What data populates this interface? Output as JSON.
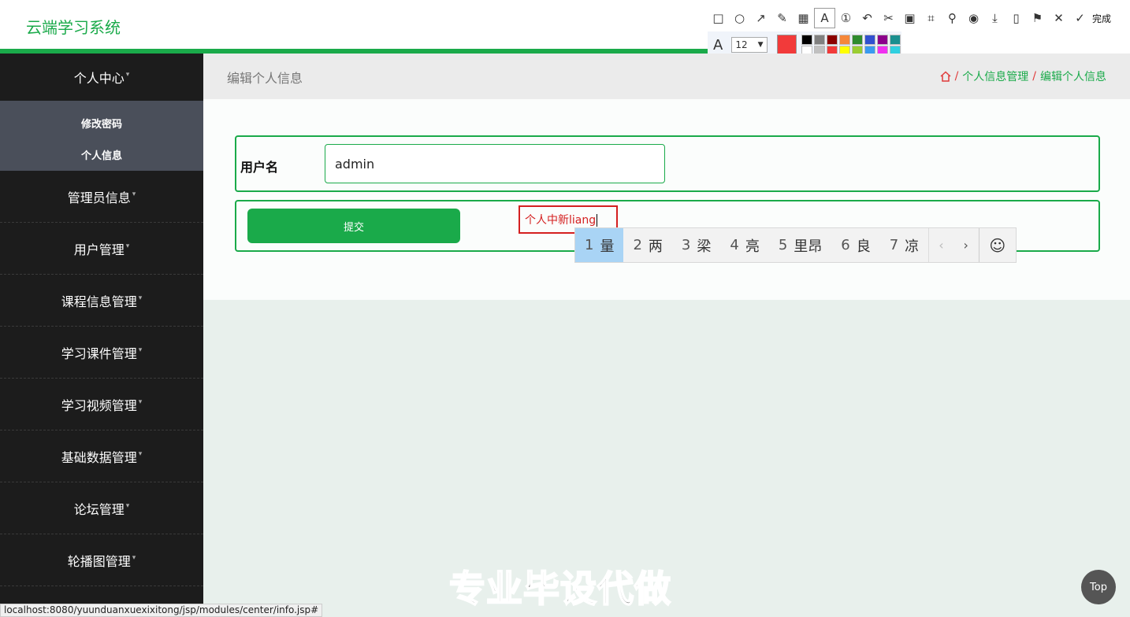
{
  "header": {
    "brand": "云端学习系统"
  },
  "sidebar": {
    "items": [
      {
        "label": "个人中心"
      },
      {
        "label": "管理员信息"
      },
      {
        "label": "用户管理"
      },
      {
        "label": "课程信息管理"
      },
      {
        "label": "学习课件管理"
      },
      {
        "label": "学习视频管理"
      },
      {
        "label": "基础数据管理"
      },
      {
        "label": "论坛管理"
      },
      {
        "label": "轮播图管理"
      }
    ],
    "submenu": [
      {
        "label": "修改密码"
      },
      {
        "label": "个人信息"
      }
    ]
  },
  "page": {
    "title": "编辑个人信息",
    "breadcrumb": [
      "个人信息管理",
      "编辑个人信息"
    ]
  },
  "form": {
    "username_label": "用户名",
    "username_value": "admin",
    "submit_label": "提交"
  },
  "annotation": {
    "text": "个人中新liang"
  },
  "ime": {
    "candidates": [
      {
        "num": "1",
        "text": "量"
      },
      {
        "num": "2",
        "text": "两"
      },
      {
        "num": "3",
        "text": "梁"
      },
      {
        "num": "4",
        "text": "亮"
      },
      {
        "num": "5",
        "text": "里昂"
      },
      {
        "num": "6",
        "text": "良"
      },
      {
        "num": "7",
        "text": "凉"
      }
    ]
  },
  "toolbar": {
    "done_label": "完成",
    "font_size": "12",
    "accent": "#f23a3a"
  },
  "watermark": "专业毕设代做",
  "status_url": "localhost:8080/yuunduanxuexixitong/jsp/modules/center/info.jsp#",
  "top_button": "Top"
}
